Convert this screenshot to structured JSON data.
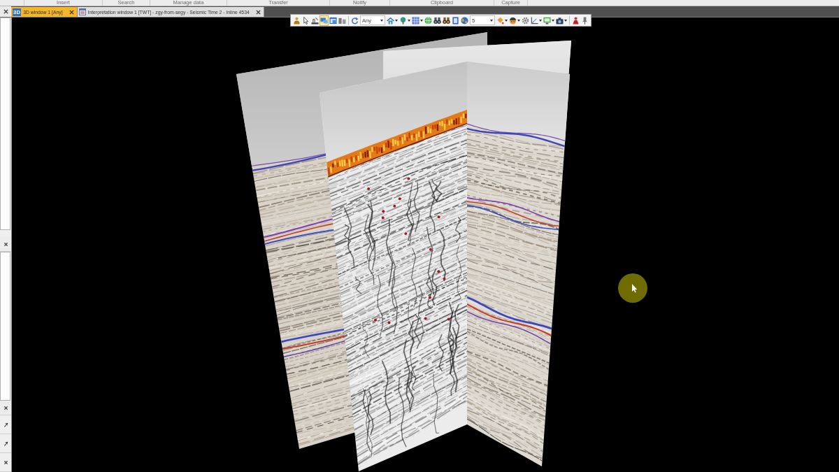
{
  "ribbon": {
    "groups": [
      "Insert",
      "Search",
      "Manage data",
      "Transfer",
      "Notify",
      "Clipboard",
      "Capture"
    ]
  },
  "tabs": [
    {
      "label": "3D window 1 [Any]",
      "icon_label": "3D",
      "selected": true
    },
    {
      "label": "Interpretation window 1 [TWT] - zgy-from-segy - Seismic Time 2 - Inline 4534",
      "selected": false
    }
  ],
  "toolbar": {
    "items": [
      {
        "kind": "tool",
        "selected": false,
        "menu": false
      },
      {
        "kind": "tool",
        "selected": false,
        "menu": false
      },
      {
        "kind": "tool",
        "selected": false,
        "menu": false
      },
      {
        "kind": "tool",
        "selected": true,
        "menu": false
      },
      {
        "kind": "tool",
        "selected": false,
        "menu": false
      },
      {
        "kind": "tool",
        "selected": false,
        "menu": false
      },
      {
        "kind": "separator"
      },
      {
        "kind": "tool",
        "selected": false,
        "menu": false
      },
      {
        "kind": "combo",
        "value": "Any"
      },
      {
        "kind": "tool",
        "selected": false,
        "menu": true
      },
      {
        "kind": "tool",
        "selected": false,
        "menu": true
      },
      {
        "kind": "tool",
        "selected": false,
        "menu": true
      },
      {
        "kind": "tool",
        "selected": false,
        "menu": false
      },
      {
        "kind": "tool",
        "selected": false,
        "menu": false
      },
      {
        "kind": "tool",
        "selected": false,
        "menu": false
      },
      {
        "kind": "tool",
        "selected": false,
        "menu": false
      },
      {
        "kind": "tool",
        "selected": false,
        "menu": false
      },
      {
        "kind": "combo",
        "value": "5"
      },
      {
        "kind": "tool",
        "selected": false,
        "menu": true
      },
      {
        "kind": "tool",
        "selected": false,
        "menu": true
      },
      {
        "kind": "tool",
        "selected": false,
        "menu": false
      },
      {
        "kind": "tool",
        "selected": false,
        "menu": true
      },
      {
        "kind": "tool",
        "selected": false,
        "menu": true
      },
      {
        "kind": "tool",
        "selected": false,
        "menu": true
      },
      {
        "kind": "separator"
      },
      {
        "kind": "tool",
        "selected": false,
        "menu": false
      },
      {
        "kind": "tool",
        "selected": false,
        "menu": false
      }
    ]
  }
}
